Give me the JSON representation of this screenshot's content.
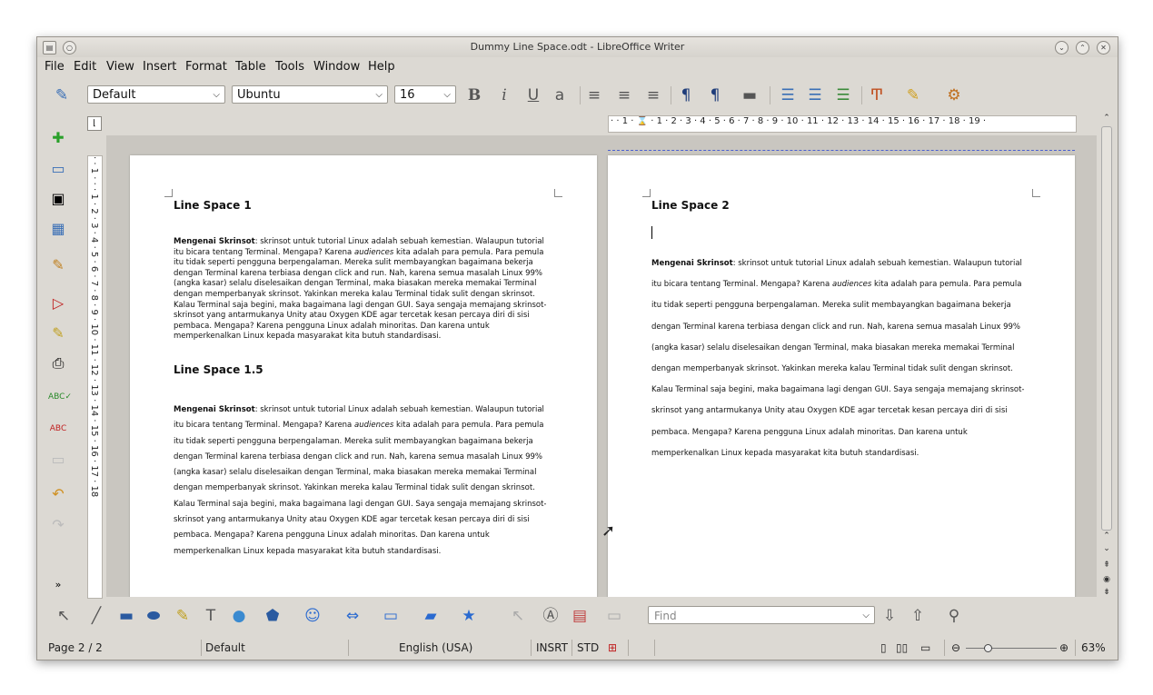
{
  "window": {
    "title": "Dummy Line Space.odt - LibreOffice Writer"
  },
  "menu": [
    "File",
    "Edit",
    "View",
    "Insert",
    "Format",
    "Table",
    "Tools",
    "Window",
    "Help"
  ],
  "formatting": {
    "style": "Default",
    "font": "Ubuntu",
    "size": "16"
  },
  "ruler": {
    "horizontal": "· · 1 · ⌛ · 1 · 2 · 3 · 4 · 5 · 6 · 7 · 8 · 9 · 10 · 11 · 12 · 13 · 14 · 15 · 16 · 17 · 18 · 19 ·",
    "vertical": "· · 1 · · · 1 · 2 · 3 · 4 · 5 · 6 · 7 · 8 · 9 · 10 · 11 · 12 · 13 · 14 · 15 · 16 · 17 · 18"
  },
  "pages": {
    "left": {
      "heading1": "Line Space 1",
      "heading2": "Line Space 1.5",
      "para_bold": "Mengenai Skrinsot",
      "para_part1": ": skrinsot untuk tutorial Linux adalah sebuah kemestian. Walaupun tutorial itu bicara tentang Terminal. Mengapa? Karena ",
      "para_italic": "audiences",
      "para_part2": " kita adalah para pemula. Para pemula itu tidak seperti pengguna berpengalaman. Mereka sulit membayangkan bagaimana bekerja dengan Terminal karena terbiasa dengan click and run. Nah, karena semua masalah Linux 99% (angka kasar) selalu diselesaikan dengan Terminal, maka biasakan mereka memakai Terminal dengan memperbanyak skrinsot. Yakinkan mereka kalau Terminal tidak sulit dengan skrinsot. Kalau Terminal saja begini, maka bagaimana lagi dengan GUI. Saya sengaja memajang skrinsot-skrinsot yang antarmukanya Unity atau Oxygen KDE agar tercetak kesan percaya diri di sisi pembaca. Mengapa? Karena pengguna Linux adalah minoritas. Dan karena untuk memperkenalkan Linux kepada masyarakat kita butuh standardisasi."
    },
    "right": {
      "heading": "Line Space 2"
    }
  },
  "find": {
    "placeholder": "Find"
  },
  "status": {
    "page": "Page 2 / 2",
    "style": "Default",
    "language": "English (USA)",
    "insert_mode": "INSRT",
    "selection_mode": "STD",
    "zoom": "63%"
  },
  "zoom_level": 0.63
}
